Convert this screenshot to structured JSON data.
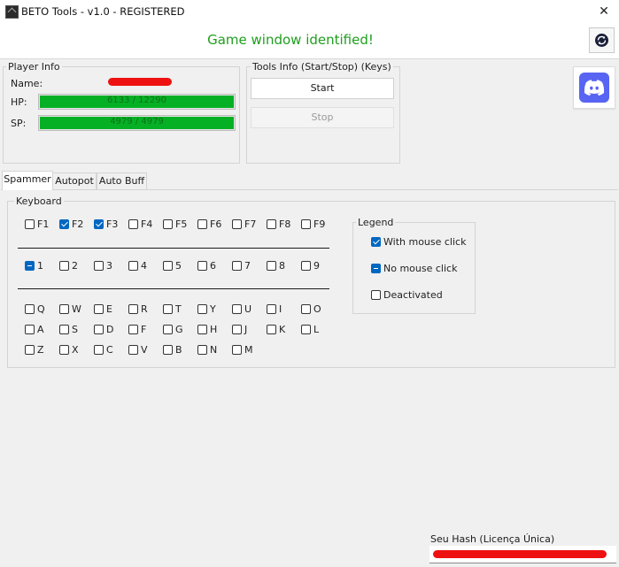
{
  "window": {
    "title": "BETO Tools - v1.0 - REGISTERED",
    "close_glyph": "✕"
  },
  "status": {
    "text": "Game window identified!",
    "color": "#1f9e1f"
  },
  "player_info": {
    "legend": "Player Info",
    "name_label": "Name:",
    "hp_label": "HP:",
    "hp_text": "6133 / 12290",
    "hp_fraction": 1.0,
    "sp_label": "SP:",
    "sp_text": "4979 / 4979",
    "sp_fraction": 1.0,
    "bar_color": "#06b025"
  },
  "tools_info": {
    "legend": "Tools Info (Start/Stop) (Keys)",
    "start_label": "Start",
    "stop_label": "Stop"
  },
  "icons": {
    "refresh": "refresh-icon",
    "discord": "discord-icon"
  },
  "tabs": [
    {
      "label": "Spammer",
      "active": true
    },
    {
      "label": "Autopot",
      "active": false
    },
    {
      "label": "Auto Buff",
      "active": false
    }
  ],
  "keyboard": {
    "legend": "Keyboard",
    "fkeys": [
      {
        "label": "F1",
        "state": "off"
      },
      {
        "label": "F2",
        "state": "checked"
      },
      {
        "label": "F3",
        "state": "checked"
      },
      {
        "label": "F4",
        "state": "off"
      },
      {
        "label": "F5",
        "state": "off"
      },
      {
        "label": "F6",
        "state": "off"
      },
      {
        "label": "F7",
        "state": "off"
      },
      {
        "label": "F8",
        "state": "off"
      },
      {
        "label": "F9",
        "state": "off"
      }
    ],
    "numbers": [
      {
        "label": "1",
        "state": "indeterminate"
      },
      {
        "label": "2",
        "state": "off"
      },
      {
        "label": "3",
        "state": "off"
      },
      {
        "label": "4",
        "state": "off"
      },
      {
        "label": "5",
        "state": "off"
      },
      {
        "label": "6",
        "state": "off"
      },
      {
        "label": "7",
        "state": "off"
      },
      {
        "label": "8",
        "state": "off"
      },
      {
        "label": "9",
        "state": "off"
      }
    ],
    "letters_row1": [
      "Q",
      "W",
      "E",
      "R",
      "T",
      "Y",
      "U",
      "I",
      "O"
    ],
    "letters_row2": [
      "A",
      "S",
      "D",
      "F",
      "G",
      "H",
      "J",
      "K",
      "L"
    ],
    "letters_row3": [
      "Z",
      "X",
      "C",
      "V",
      "B",
      "N",
      "M"
    ]
  },
  "legend_box": {
    "legend": "Legend",
    "items": [
      {
        "label": "With mouse click",
        "state": "checked"
      },
      {
        "label": "No mouse click",
        "state": "indeterminate"
      },
      {
        "label": "Deactivated",
        "state": "off"
      }
    ]
  },
  "license": {
    "label": "Seu Hash (Licença Única)"
  },
  "colors": {
    "accent": "#0067c0",
    "redaction": "#ee1111"
  }
}
